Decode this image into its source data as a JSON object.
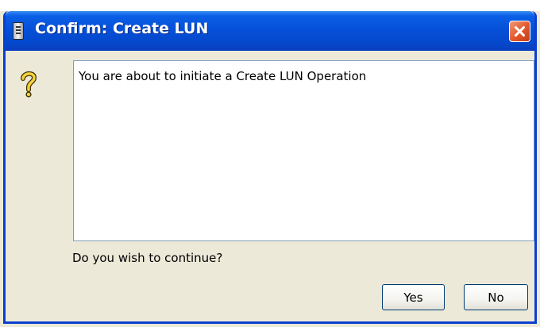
{
  "background": {
    "partial_text": "~~~ ~~~ ~~~          ~~ ~~~~~~"
  },
  "dialog": {
    "title": "Confirm: Create LUN",
    "message": "You are about to initiate a Create LUN Operation",
    "prompt": "Do you wish to continue?",
    "buttons": {
      "yes_label": "Yes",
      "no_label": "No"
    }
  },
  "icons": {
    "title_icon": "server-icon",
    "close_icon": "close-icon",
    "message_icon": "question-mark-icon"
  },
  "colors": {
    "title_bar": "#0650d8",
    "close_button": "#e2552a",
    "dialog_background": "#ece9d8",
    "question_icon": "#f5d23c"
  }
}
